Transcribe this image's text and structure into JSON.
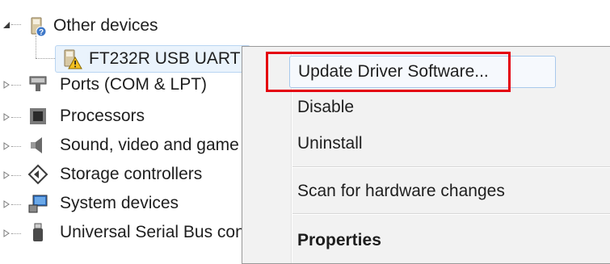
{
  "tree": {
    "other_devices": "Other devices",
    "ft232r": "FT232R USB UART",
    "ports": "Ports (COM & LPT)",
    "processors": "Processors",
    "sound": "Sound, video and game controllers",
    "storage": "Storage controllers",
    "system": "System devices",
    "usb": "Universal Serial Bus controllers"
  },
  "context_menu": {
    "update_driver": "Update Driver Software...",
    "disable": "Disable",
    "uninstall": "Uninstall",
    "scan": "Scan for hardware changes",
    "properties": "Properties"
  },
  "colors": {
    "highlight_outline": "#e4000e",
    "selection": "#eaf3fc",
    "menu_background": "#f2f2f2"
  },
  "icons": {
    "other_devices": "unknown-device-icon",
    "ft232r": "warning-device-icon",
    "ports": "port-connector-icon",
    "processors": "processor-chip-icon",
    "sound": "speaker-icon",
    "storage": "storage-controller-icon",
    "system": "system-devices-icon",
    "usb": "usb-plug-icon"
  }
}
